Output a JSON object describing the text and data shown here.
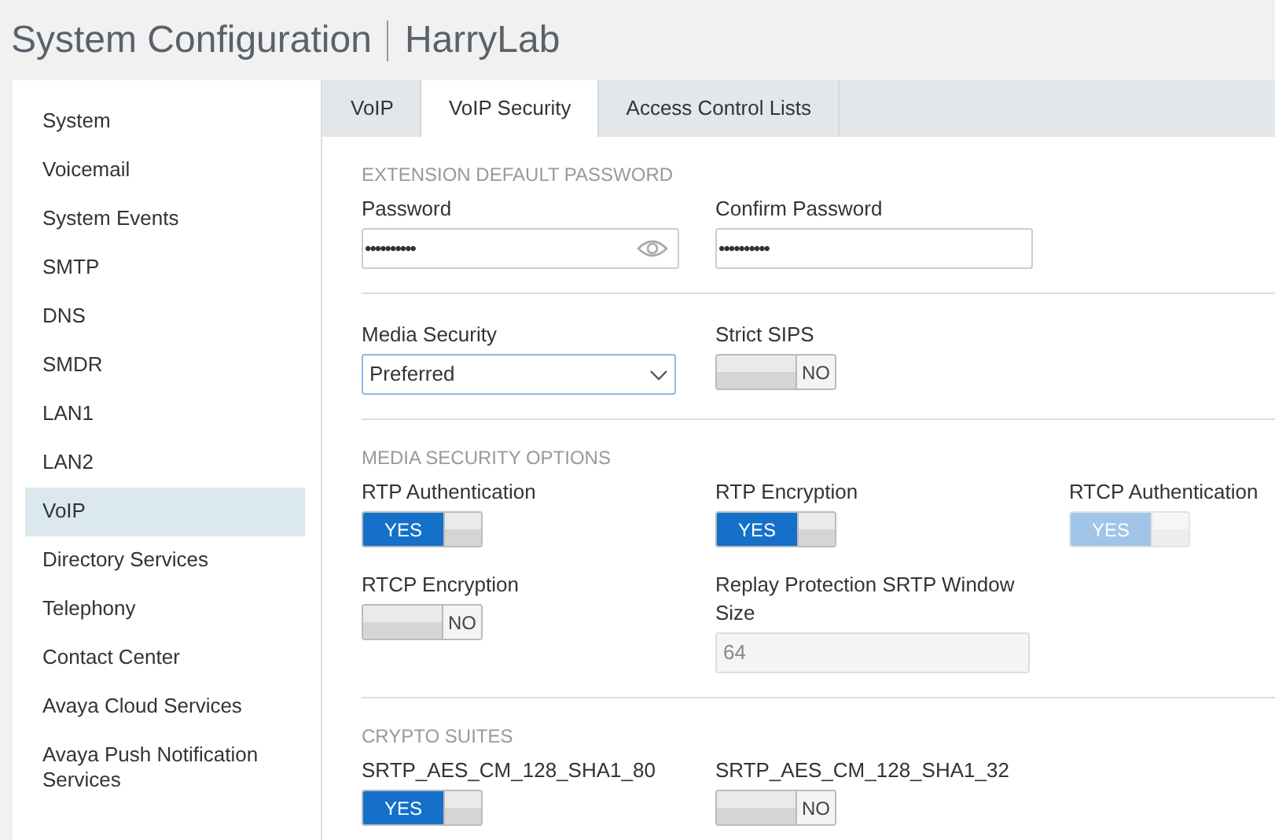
{
  "header": {
    "title": "System Configuration",
    "subtitle": "HarryLab"
  },
  "sidebar": {
    "items": [
      {
        "label": "System",
        "selected": false
      },
      {
        "label": "Voicemail",
        "selected": false
      },
      {
        "label": "System Events",
        "selected": false
      },
      {
        "label": "SMTP",
        "selected": false
      },
      {
        "label": "DNS",
        "selected": false
      },
      {
        "label": "SMDR",
        "selected": false
      },
      {
        "label": "LAN1",
        "selected": false
      },
      {
        "label": "LAN2",
        "selected": false
      },
      {
        "label": "VoIP",
        "selected": true
      },
      {
        "label": "Directory Services",
        "selected": false
      },
      {
        "label": "Telephony",
        "selected": false
      },
      {
        "label": "Contact Center",
        "selected": false
      },
      {
        "label": "Avaya Cloud Services",
        "selected": false
      },
      {
        "label": "Avaya Push Notification Services",
        "selected": false
      }
    ]
  },
  "tabs": [
    {
      "label": "VoIP",
      "selected": false
    },
    {
      "label": "VoIP Security",
      "selected": true
    },
    {
      "label": "Access Control Lists",
      "selected": false
    }
  ],
  "sections": [
    {
      "heading": "EXTENSION DEFAULT PASSWORD",
      "fields": [
        {
          "kind": "password",
          "label": "Password",
          "value": "••••••••••",
          "reveal_icon": true
        },
        {
          "kind": "password",
          "label": "Confirm Password",
          "value": "••••••••••",
          "reveal_icon": false
        }
      ]
    },
    {
      "fields": [
        {
          "kind": "select",
          "label": "Media Security",
          "value": "Preferred"
        },
        {
          "kind": "toggle",
          "label": "Strict SIPS",
          "on": false,
          "disabled": false,
          "text": "NO"
        }
      ]
    },
    {
      "heading": "MEDIA SECURITY OPTIONS",
      "fields": [
        {
          "kind": "toggle",
          "label": "RTP Authentication",
          "on": true,
          "disabled": false,
          "text": "YES"
        },
        {
          "kind": "toggle",
          "label": "RTP Encryption",
          "on": true,
          "disabled": false,
          "text": "YES"
        },
        {
          "kind": "toggle",
          "label": "RTCP Authentication",
          "on": true,
          "disabled": true,
          "text": "YES"
        },
        {
          "kind": "toggle",
          "label": "RTCP Encryption",
          "on": false,
          "disabled": false,
          "text": "NO"
        },
        {
          "kind": "text",
          "label": "Replay Protection SRTP Window Size",
          "value": "64",
          "disabled": true
        }
      ]
    },
    {
      "heading": "CRYPTO SUITES",
      "fields": [
        {
          "kind": "toggle",
          "label": "SRTP_AES_CM_128_SHA1_80",
          "on": true,
          "disabled": false,
          "text": "YES"
        },
        {
          "kind": "toggle",
          "label": "SRTP_AES_CM_128_SHA1_32",
          "on": false,
          "disabled": false,
          "text": "NO"
        }
      ]
    }
  ]
}
